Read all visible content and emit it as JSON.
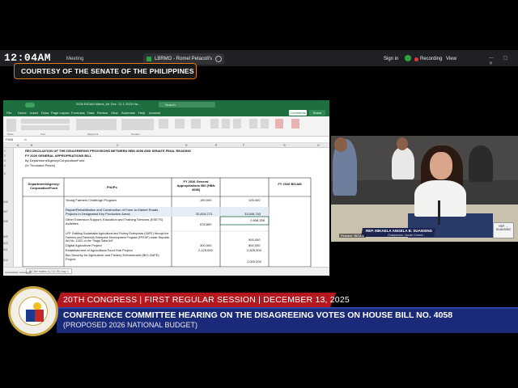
{
  "meeting_bar": {
    "clock": "12:04AM",
    "meeting_label": "Meeting",
    "screen_share_label": "LBRMO - Romel Petacoli's screen",
    "sign_in": "Sign in",
    "recording": "Recording",
    "view": "View"
  },
  "courtesy": "COURTESY OF THE SENATE OF THE PHILIPPINES",
  "excel": {
    "filename": "2026 BICAM Matrix_for Dec. 12 1 2025 Ha...",
    "search_placeholder": "Search",
    "menu": [
      "Home",
      "Insert",
      "Draw",
      "Page Layout",
      "Formulas",
      "Data",
      "Review",
      "View",
      "Automate",
      "Help",
      "Acrobat"
    ],
    "comments_button": "Comments",
    "share_button": "Share",
    "ribbon_groups": [
      "Paste",
      "Font",
      "Alignment",
      "Number",
      "Conditional Formatting",
      "Format as Table",
      "Cell Styles",
      "Insert",
      "Delete",
      "Format",
      "Sort & Filter",
      "Find & Select",
      "Create PDF",
      "Create PDF and share link"
    ],
    "name_box": "F608",
    "columns": [
      "A",
      "B",
      "C",
      "D",
      "E",
      "F",
      "G",
      "H"
    ],
    "title_lines": [
      "RECONCILIATION OF THE DISAGREEING PROVISIONS BETWEEN HBN 4058 AND SENATE FINAL READING",
      "FY 2026 GENERAL APPROPRIATIONS BILL",
      "By Department/Agency/Corporation/Fund",
      "(In Thousand Pesos)"
    ],
    "header": {
      "col1": "Department/Agency/ Corporation/Fund",
      "col2": "P/A/Ps",
      "col3": "FY 2026 General Appropriations Bill (HBN 4058)",
      "col4": "FY 2026 BICAM"
    },
    "rows": [
      {
        "row": "606",
        "pap": "Young Farmers Challenge Program",
        "gab": "150,000",
        "bicam": "125,000"
      },
      {
        "row": "607",
        "pap": "Repair/Rehabilitation and Construction of Farm-to-Market Roads Projects in Designated Key Production Areas",
        "gab": "32,819,273",
        "bicam": "33,508,763"
      },
      {
        "row": "608",
        "pap": "Other Extension Support, Education and Training Services (ESETS) Activities",
        "gab": "578,800",
        "bicam": "0 808,339"
      },
      {
        "row": "609",
        "pap": "LFP: Building Sustainable Agricultural and Fishery Enterprises (SAFE) through the Farmers and Fisherfolk Enterprise Development Program (FFEDP) under Republic Act No. 11321 or the \"Sagip Saka Act\"",
        "gab": "",
        "bicam": "500,000"
      },
      {
        "row": "610",
        "pap": "Digital Agriculture Project",
        "gab": "300,000",
        "bicam": "800,000"
      },
      {
        "row": "611",
        "pap": "Establishment of Agricultural Food Hub Project",
        "gab": "2,125,000",
        "bicam": "2,825,000"
      },
      {
        "row": "612",
        "pap": "Bio-Security for Agriculture and Fishery Enforcement (BIO-SAFE) Project",
        "gab": "",
        "bicam": "1,000,000"
      }
    ],
    "sheet_tab": "BICAM Matrix (12.12.25) Day 3",
    "status": "Accessibility: Investigate"
  },
  "camera": {
    "name_label": "REP. MIKAELA ANGELA B. SUANSING",
    "name_sub": "Chairperson, House Commi...",
    "card_text": "REP. ... SUANSING",
    "tag": "Finance: BICAM"
  },
  "lower_third": {
    "session": "20TH CONGRESS | FIRST REGULAR SESSION | DECEMBER 13, 2025",
    "headline": "CONFERENCE COMMITTEE HEARING ON THE DISAGREEING VOTES ON HOUSE BILL NO. 4058",
    "subline": "(PROPOSED 2026 NATIONAL BUDGET)",
    "seal_text": "SENATE OF THE PHILIPPINES"
  },
  "colors": {
    "excel_green": "#1e6f3f",
    "banner_red": "#b5171f",
    "banner_blue": "#1b2a78",
    "courtesy_border": "#e07a1f"
  }
}
